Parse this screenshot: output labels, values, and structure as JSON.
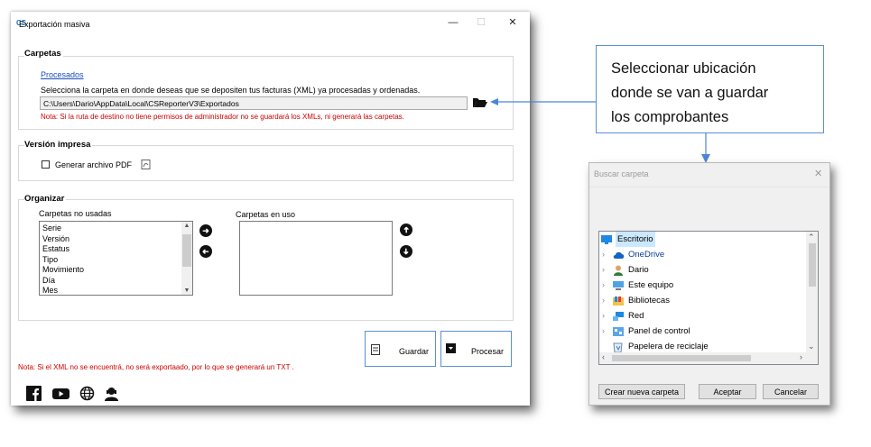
{
  "window": {
    "title": "Exportación masiva",
    "app_icon_text": "CS",
    "minimize_glyph": "—",
    "maximize_glyph": "☐",
    "close_glyph": "✕"
  },
  "carpetas": {
    "title": "Carpetas",
    "link_label": "Procesados",
    "description": "Selecciona la carpeta en donde deseas que se depositen tus facturas (XML) ya procesadas y ordenadas.",
    "path_value": "C:\\Users\\Dario\\AppData\\Local\\CSReporterV3\\Exportados",
    "browse_icon": "open-folder-icon",
    "note": "Nota: Si la ruta de destino no tiene permisos de administrador no se guardará los XMLs,  ni generará las carpetas."
  },
  "version_impresa": {
    "title": "Versión impresa",
    "checkbox_label": "Generar archivo PDF",
    "checkbox_checked": false
  },
  "organizar": {
    "title": "Organizar",
    "unused_label": "Carpetas no usadas",
    "used_label": "Carpetas en uso",
    "unused_items": [
      "Serie",
      "Versión",
      "Estatus",
      "Tipo",
      "Movimiento",
      "Día",
      "Mes"
    ],
    "used_items": []
  },
  "actions": {
    "save_label": "Guardar",
    "process_label": "Procesar",
    "footer_note": "Nota: Si el XML no se encuentrá, no será exportaado, por lo que se generará un TXT ."
  },
  "social_icons": [
    "facebook-icon",
    "youtube-icon",
    "globe-icon",
    "support-agent-icon"
  ],
  "callout": {
    "line1": "Seleccionar ubicación",
    "line2": "donde se van a guardar",
    "line3": "los comprobantes"
  },
  "folder_dialog": {
    "title": "Buscar carpeta",
    "close_glyph": "✕",
    "tree": [
      {
        "label": "Escritorio",
        "icon": "desktop-icon",
        "selected": true
      },
      {
        "label": "OneDrive",
        "icon": "onedrive-cloud-icon"
      },
      {
        "label": "Dario",
        "icon": "user-folder-icon"
      },
      {
        "label": "Este equipo",
        "icon": "computer-icon"
      },
      {
        "label": "Bibliotecas",
        "icon": "libraries-icon"
      },
      {
        "label": "Red",
        "icon": "network-icon"
      },
      {
        "label": "Panel de control",
        "icon": "control-panel-icon"
      },
      {
        "label": "Papelera de reciclaje",
        "icon": "recycle-bin-icon"
      }
    ],
    "new_folder_label": "Crear nueva carpeta",
    "accept_label": "Aceptar",
    "cancel_label": "Cancelar"
  },
  "colors": {
    "link": "#1a4fb8",
    "note_red": "#cc0000",
    "accent_border": "#5b8fd8",
    "arrow_blue": "#4a86d8"
  }
}
